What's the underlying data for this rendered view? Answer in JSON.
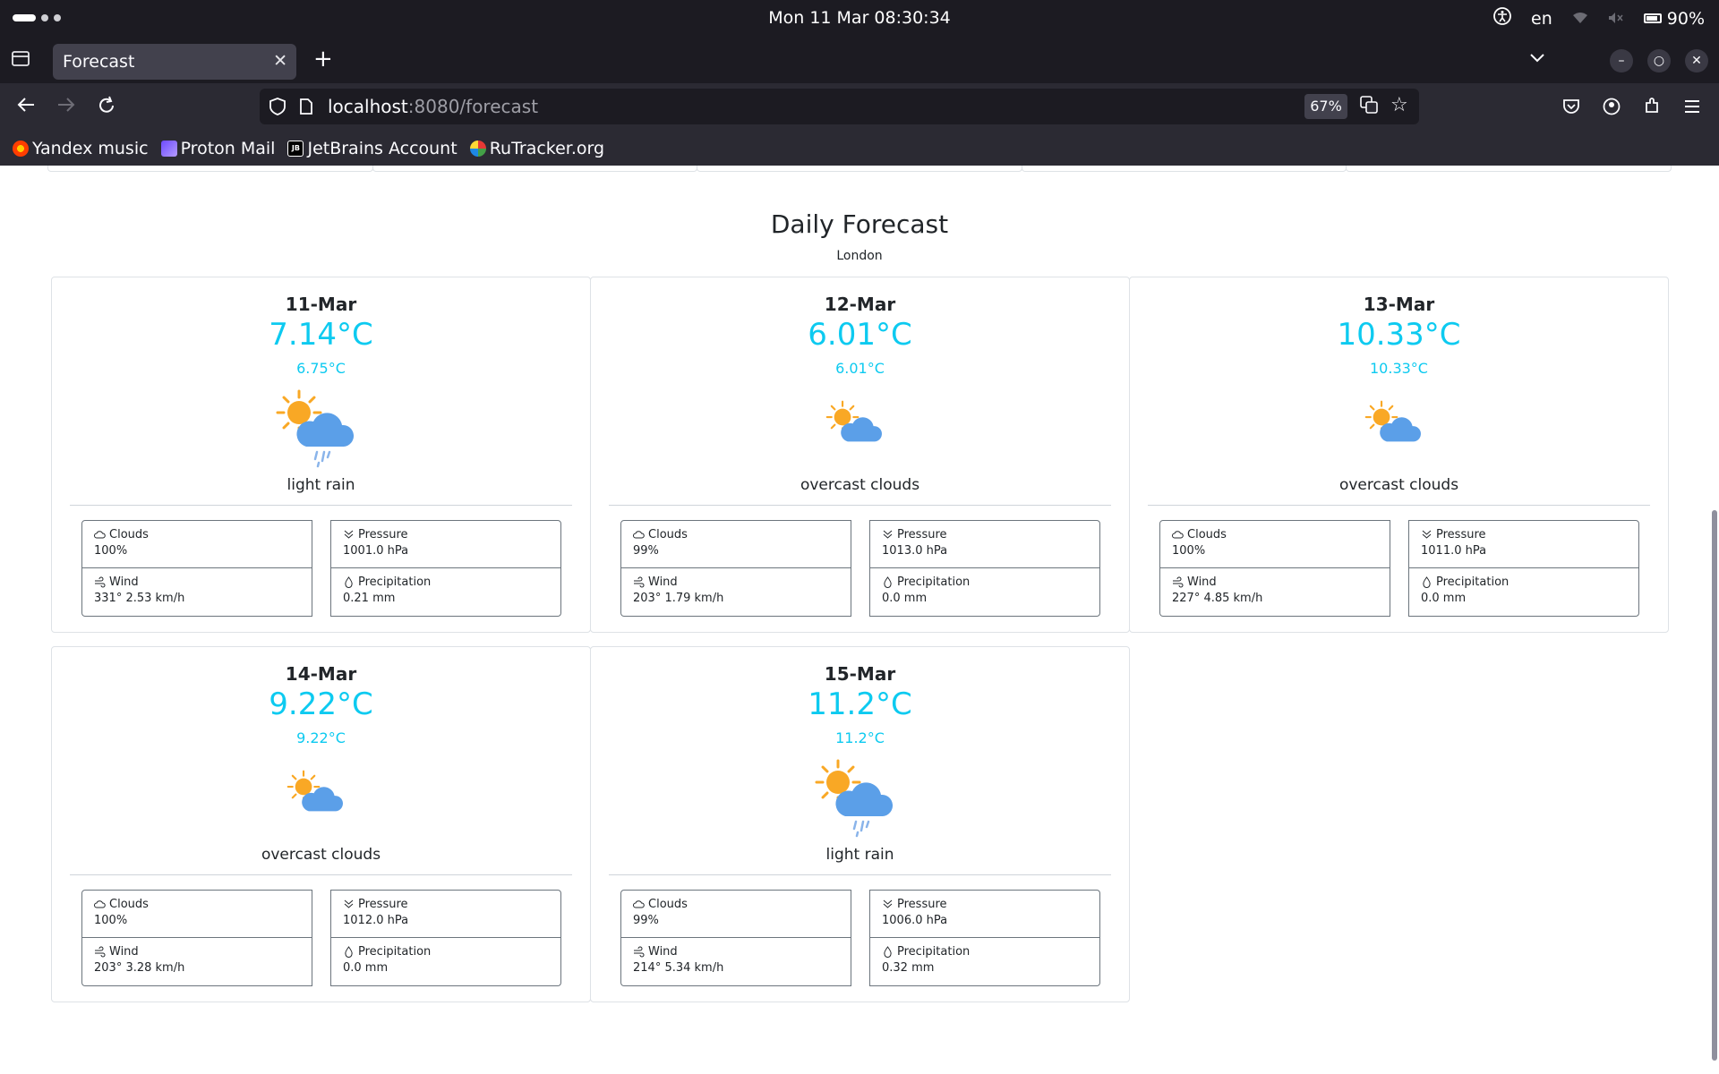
{
  "os": {
    "clock": "Mon 11 Mar  08:30:34",
    "language": "en",
    "battery": "90%"
  },
  "browser": {
    "tab_title": "Forecast",
    "url_host": "localhost",
    "url_rest": ":8080/forecast",
    "zoom": "67%",
    "bookmarks": [
      {
        "label": "Yandex music",
        "icon": "yandex-music-icon"
      },
      {
        "label": "Proton Mail",
        "icon": "proton-mail-icon"
      },
      {
        "label": "JetBrains Account",
        "icon": "jetbrains-icon"
      },
      {
        "label": "RuTracker.org",
        "icon": "rutracker-icon"
      }
    ]
  },
  "forecast": {
    "title": "Daily Forecast",
    "city": "London",
    "labels": {
      "clouds": "Clouds",
      "pressure": "Pressure",
      "wind": "Wind",
      "precipitation": "Precipitation"
    },
    "days": [
      {
        "date": "11-Mar",
        "temp": "7.14°C",
        "feels": "6.75°C",
        "desc": "light rain",
        "icon": "sun-cloud-rain-icon",
        "clouds": "100%",
        "pressure": "1001.0 hPa",
        "wind": "331° 2.53 km/h",
        "precipitation": "0.21 mm"
      },
      {
        "date": "12-Mar",
        "temp": "6.01°C",
        "feels": "6.01°C",
        "desc": "overcast clouds",
        "icon": "sun-cloud-icon",
        "clouds": "99%",
        "pressure": "1013.0 hPa",
        "wind": "203° 1.79 km/h",
        "precipitation": "0.0 mm"
      },
      {
        "date": "13-Mar",
        "temp": "10.33°C",
        "feels": "10.33°C",
        "desc": "overcast clouds",
        "icon": "sun-cloud-icon",
        "clouds": "100%",
        "pressure": "1011.0 hPa",
        "wind": "227° 4.85 km/h",
        "precipitation": "0.0 mm"
      },
      {
        "date": "14-Mar",
        "temp": "9.22°C",
        "feels": "9.22°C",
        "desc": "overcast clouds",
        "icon": "sun-cloud-icon",
        "clouds": "100%",
        "pressure": "1012.0 hPa",
        "wind": "203° 3.28 km/h",
        "precipitation": "0.0 mm"
      },
      {
        "date": "15-Mar",
        "temp": "11.2°C",
        "feels": "11.2°C",
        "desc": "light rain",
        "icon": "sun-cloud-rain-icon",
        "clouds": "99%",
        "pressure": "1006.0 hPa",
        "wind": "214° 5.34 km/h",
        "precipitation": "0.32 mm"
      }
    ]
  },
  "colors": {
    "accent": "#0dcaf0",
    "sun": "#f9a825",
    "cloud": "#5b9fe8"
  }
}
